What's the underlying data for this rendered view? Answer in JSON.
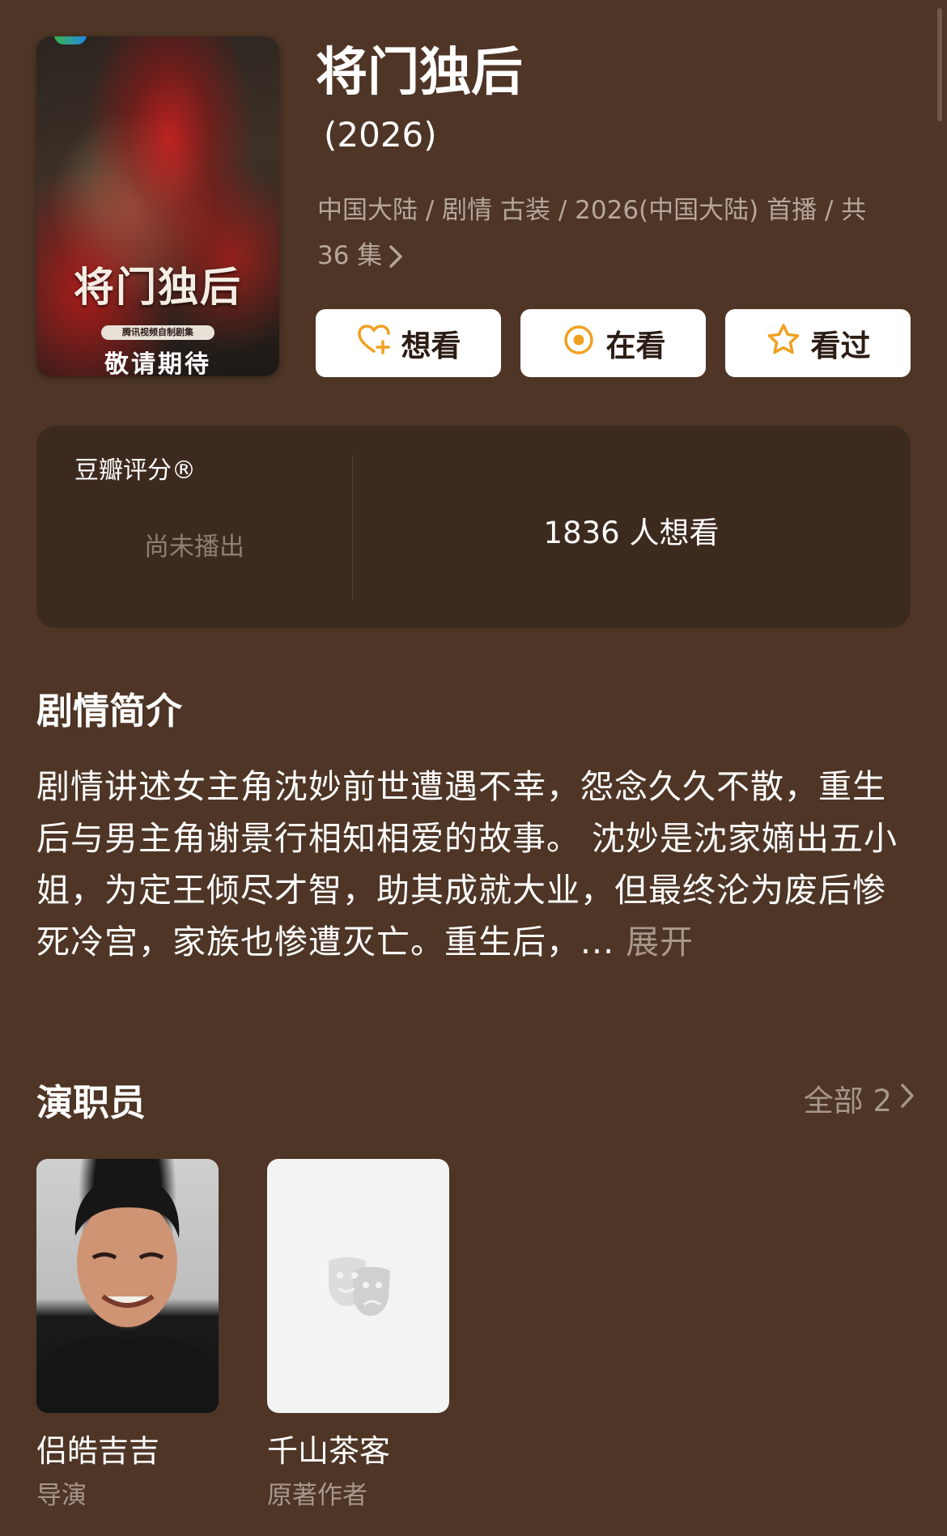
{
  "poster": {
    "title": "将门独后",
    "badge": "腾讯视频自制剧集",
    "subtitle": "敬请期待"
  },
  "header": {
    "title": "将门独后",
    "year": "(2026)",
    "meta_line1": "中国大陆 / 剧情 古装 / 2026(中国大陆) 首播 / 共",
    "meta_line2": "36 集"
  },
  "actions": [
    {
      "label": "想看",
      "icon": "heart-plus-icon"
    },
    {
      "label": "在看",
      "icon": "target-circle-icon"
    },
    {
      "label": "看过",
      "icon": "star-icon"
    }
  ],
  "rating": {
    "label": "豆瓣评分®",
    "status": "尚未播出",
    "wish_count": "1836 人想看"
  },
  "synopsis": {
    "heading": "剧情简介",
    "text": "剧情讲述女主角沈妙前世遭遇不幸，怨念久久不散，重生后与男主角谢景行相知相爱的故事。 沈妙是沈家嫡出五小姐，为定王倾尽才智，助其成就大业，但最终沦为废后惨死冷宫，家族也惨遭灭亡。重生后，...",
    "expand_label": "展开"
  },
  "cast": {
    "heading": "演职员",
    "all_label": "全部 2",
    "members": [
      {
        "name": "侣皓吉吉",
        "role": "导演"
      },
      {
        "name": "千山茶客",
        "role": "原著作者"
      }
    ]
  },
  "colors": {
    "background": "#4e3526",
    "card": "#3d2a1f",
    "accent": "#f0a020",
    "muted_text": "#a8978b"
  }
}
